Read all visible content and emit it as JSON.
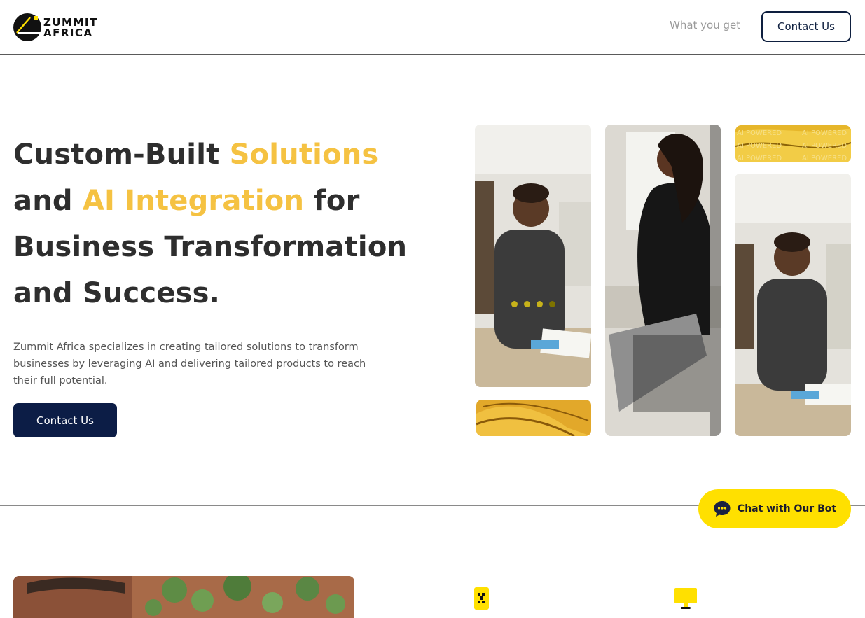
{
  "header": {
    "logo": {
      "line1": "ZUMMIT",
      "line2": "AFRICA",
      "icon": "zummit-logo-icon"
    },
    "nav_link": "What you get",
    "contact_button": "Contact Us"
  },
  "hero": {
    "title_parts": {
      "p1": "Custom-Built ",
      "h1": "Solutions",
      "p2": "and ",
      "h2": "AI Integration",
      "p3": " for",
      "p4": "Business Transformation",
      "p5": "and Success."
    },
    "description": "Zummit Africa specializes in creating tailored solutions to transform businesses by leveraging AI and delivering tailored products to reach their full potential.",
    "cta": "Contact Us",
    "highlight_color": "#f5c242",
    "tile_overlay_text": "AI POWERED"
  },
  "chat": {
    "label": "Chat with Our Bot",
    "icon": "chat-bubble-icon"
  },
  "colors": {
    "navy": "#0c1d46",
    "yellow": "#ffe000"
  },
  "features": {
    "icon1": "phone-icon",
    "icon2": "monitor-icon"
  }
}
